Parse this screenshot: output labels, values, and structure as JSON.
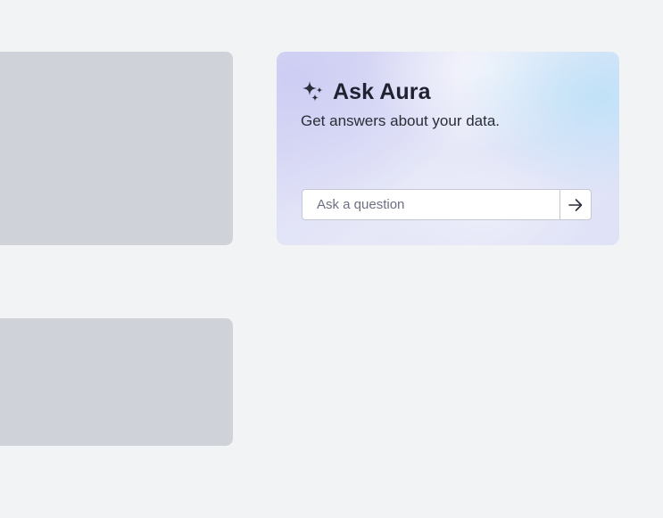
{
  "aura": {
    "title": "Ask Aura",
    "subtitle": "Get answers about your data.",
    "input_placeholder": "Ask a question",
    "input_value": "",
    "title_icon": "sparkles-icon",
    "send_icon": "arrow-right-icon"
  },
  "colors": {
    "page_background": "#f2f3f5",
    "placeholder_block": "#cfd3d9",
    "text_primary": "#1f2230",
    "input_border": "#c4c8d2"
  }
}
